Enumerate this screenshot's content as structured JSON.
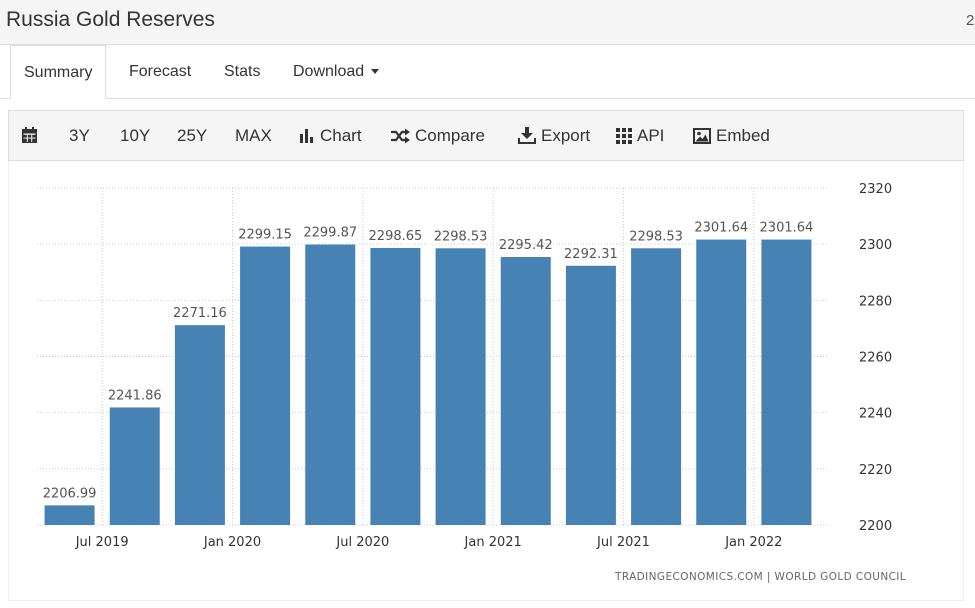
{
  "header": {
    "title": "Russia Gold Reserves",
    "extra": "2"
  },
  "tabs": [
    {
      "label": "Summary"
    },
    {
      "label": "Forecast"
    },
    {
      "label": "Stats"
    },
    {
      "label": "Download"
    }
  ],
  "toolbar": {
    "ranges": [
      "3Y",
      "10Y",
      "25Y",
      "MAX"
    ],
    "chart_label": "Chart",
    "compare_label": "Compare",
    "export_label": "Export",
    "api_label": "API",
    "embed_label": "Embed"
  },
  "chart_data": {
    "type": "bar",
    "categories": [
      "2019-Q2",
      "2019-Q3",
      "2019-Q4",
      "2020-Q1",
      "2020-Q2",
      "2020-Q3",
      "2020-Q4",
      "2021-Q1",
      "2021-Q2",
      "2021-Q3",
      "2021-Q4",
      "2022-Q1"
    ],
    "values": [
      2206.99,
      2241.86,
      2271.16,
      2299.15,
      2299.87,
      2298.65,
      2298.53,
      2295.42,
      2292.31,
      2298.53,
      2301.64,
      2301.64
    ],
    "value_labels": [
      "2206.99",
      "2241.86",
      "2271.16",
      "2299.15",
      "2299.87",
      "2298.65",
      "2298.53",
      "2295.42",
      "2292.31",
      "2298.53",
      "2301.64",
      "2301.64"
    ],
    "x_tick_labels": [
      {
        "label": "Jul 2019",
        "at": 0.5
      },
      {
        "label": "Jan 2020",
        "at": 2.5
      },
      {
        "label": "Jul 2020",
        "at": 4.5
      },
      {
        "label": "Jan 2021",
        "at": 6.5
      },
      {
        "label": "Jul 2021",
        "at": 8.5
      },
      {
        "label": "Jan 2022",
        "at": 10.5
      }
    ],
    "y_ticks": [
      2200,
      2220,
      2240,
      2260,
      2280,
      2300,
      2320
    ],
    "ylim": [
      2200,
      2320
    ],
    "bar_color": "#4682b4",
    "grid": true,
    "y_axis_side": "right",
    "source": "TRADINGECONOMICS.COM  |  WORLD GOLD COUNCIL"
  }
}
